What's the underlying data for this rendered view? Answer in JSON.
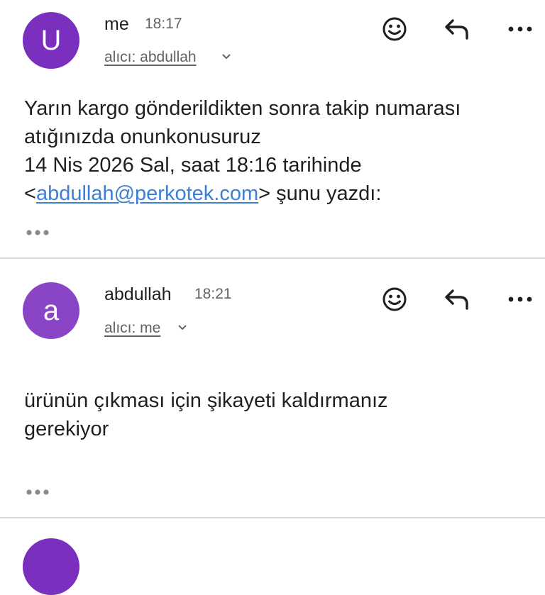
{
  "messages": [
    {
      "avatar_letter": "U",
      "sender": "me",
      "time": "18:17",
      "recipient": "alıcı: abdullah",
      "body_line1": "Yarın kargo gönderildikten sonra takip numarası",
      "body_line2": "atığınızda onunkonusuruz",
      "quote_line": "14 Nis 2026 Sal, saat 18:16 tarihinde",
      "quote_open": "<",
      "quote_email": "abdullah@perkotek.com",
      "quote_close": "> şunu yazdı:"
    },
    {
      "avatar_letter": "a",
      "sender": "abdullah",
      "time": "18:21",
      "recipient": "alıcı: me",
      "body_line1": "ürünün çıkması için şikayeti kaldırmanız",
      "body_line2": "gerekiyor"
    }
  ],
  "icons": {
    "emoji": "smiley-icon",
    "reply": "reply-icon",
    "more": "more-icon",
    "expand": "chevron-down-icon",
    "quoted": "ellipsis-icon"
  },
  "colors": {
    "avatar1": "#7b2fbf",
    "avatar2": "#8a44c6",
    "link": "#3d7fd6",
    "divider": "#d9d9d9"
  }
}
